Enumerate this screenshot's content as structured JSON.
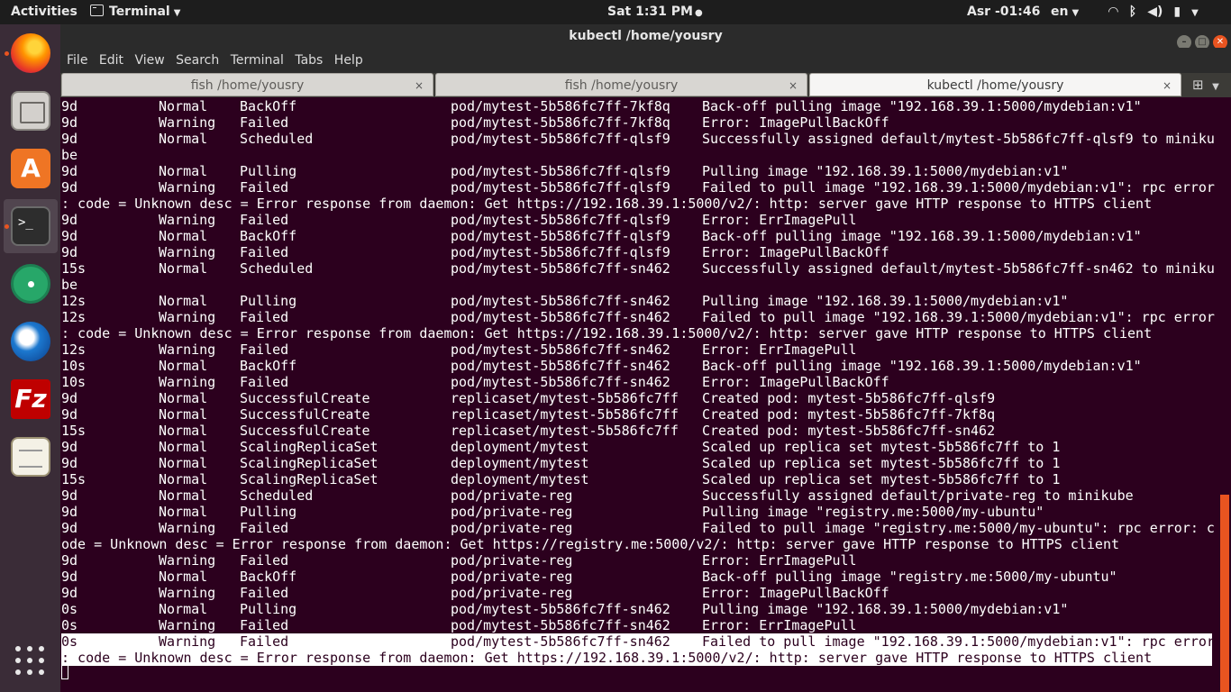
{
  "topbar": {
    "activities": "Activities",
    "app_name": "Terminal",
    "clock": "Sat  1:31 PM",
    "prayer": "Asr -01:46",
    "language": "en"
  },
  "dock": {
    "items": [
      "firefox-icon",
      "files-icon",
      "software-icon",
      "terminal-icon",
      "atom-icon",
      "thunderbird-icon",
      "filezilla-icon",
      "text-editor-icon"
    ],
    "software_glyph": "A",
    "terminal_glyph": ">_",
    "filezilla_glyph": "Fz"
  },
  "window": {
    "title": "kubectl  /home/yousry",
    "menu": [
      "File",
      "Edit",
      "View",
      "Search",
      "Terminal",
      "Tabs",
      "Help"
    ],
    "tabs": [
      {
        "label": "fish  /home/yousry"
      },
      {
        "label": "fish  /home/yousry"
      },
      {
        "label": "kubectl  /home/yousry"
      }
    ]
  },
  "colors": {
    "terminal_bg": "#2c001e",
    "accent": "#e95420",
    "titlebar": "#2b2b2b"
  },
  "terminal": {
    "lines": [
      {
        "t": "row",
        "c": [
          "9d",
          "Normal",
          "BackOff",
          "pod/mytest-5b586fc7ff-7kf8q",
          "Back-off pulling image \"192.168.39.1:5000/mydebian:v1\""
        ]
      },
      {
        "t": "row",
        "c": [
          "9d",
          "Warning",
          "Failed",
          "pod/mytest-5b586fc7ff-7kf8q",
          "Error: ImagePullBackOff"
        ]
      },
      {
        "t": "row",
        "c": [
          "9d",
          "Normal",
          "Scheduled",
          "pod/mytest-5b586fc7ff-qlsf9",
          "Successfully assigned default/mytest-5b586fc7ff-qlsf9 to miniku"
        ]
      },
      {
        "t": "wrap",
        "s": "be"
      },
      {
        "t": "row",
        "c": [
          "9d",
          "Normal",
          "Pulling",
          "pod/mytest-5b586fc7ff-qlsf9",
          "Pulling image \"192.168.39.1:5000/mydebian:v1\""
        ]
      },
      {
        "t": "row",
        "c": [
          "9d",
          "Warning",
          "Failed",
          "pod/mytest-5b586fc7ff-qlsf9",
          "Failed to pull image \"192.168.39.1:5000/mydebian:v1\": rpc error"
        ]
      },
      {
        "t": "wrap",
        "s": ": code = Unknown desc = Error response from daemon: Get https://192.168.39.1:5000/v2/: http: server gave HTTP response to HTTPS client"
      },
      {
        "t": "row",
        "c": [
          "9d",
          "Warning",
          "Failed",
          "pod/mytest-5b586fc7ff-qlsf9",
          "Error: ErrImagePull"
        ]
      },
      {
        "t": "row",
        "c": [
          "9d",
          "Normal",
          "BackOff",
          "pod/mytest-5b586fc7ff-qlsf9",
          "Back-off pulling image \"192.168.39.1:5000/mydebian:v1\""
        ]
      },
      {
        "t": "row",
        "c": [
          "9d",
          "Warning",
          "Failed",
          "pod/mytest-5b586fc7ff-qlsf9",
          "Error: ImagePullBackOff"
        ]
      },
      {
        "t": "row",
        "c": [
          "15s",
          "Normal",
          "Scheduled",
          "pod/mytest-5b586fc7ff-sn462",
          "Successfully assigned default/mytest-5b586fc7ff-sn462 to miniku"
        ]
      },
      {
        "t": "wrap",
        "s": "be"
      },
      {
        "t": "row",
        "c": [
          "12s",
          "Normal",
          "Pulling",
          "pod/mytest-5b586fc7ff-sn462",
          "Pulling image \"192.168.39.1:5000/mydebian:v1\""
        ]
      },
      {
        "t": "row",
        "c": [
          "12s",
          "Warning",
          "Failed",
          "pod/mytest-5b586fc7ff-sn462",
          "Failed to pull image \"192.168.39.1:5000/mydebian:v1\": rpc error"
        ]
      },
      {
        "t": "wrap",
        "s": ": code = Unknown desc = Error response from daemon: Get https://192.168.39.1:5000/v2/: http: server gave HTTP response to HTTPS client"
      },
      {
        "t": "row",
        "c": [
          "12s",
          "Warning",
          "Failed",
          "pod/mytest-5b586fc7ff-sn462",
          "Error: ErrImagePull"
        ]
      },
      {
        "t": "row",
        "c": [
          "10s",
          "Normal",
          "BackOff",
          "pod/mytest-5b586fc7ff-sn462",
          "Back-off pulling image \"192.168.39.1:5000/mydebian:v1\""
        ]
      },
      {
        "t": "row",
        "c": [
          "10s",
          "Warning",
          "Failed",
          "pod/mytest-5b586fc7ff-sn462",
          "Error: ImagePullBackOff"
        ]
      },
      {
        "t": "row",
        "c": [
          "9d",
          "Normal",
          "SuccessfulCreate",
          "replicaset/mytest-5b586fc7ff",
          "Created pod: mytest-5b586fc7ff-qlsf9"
        ]
      },
      {
        "t": "row",
        "c": [
          "9d",
          "Normal",
          "SuccessfulCreate",
          "replicaset/mytest-5b586fc7ff",
          "Created pod: mytest-5b586fc7ff-7kf8q"
        ]
      },
      {
        "t": "row",
        "c": [
          "15s",
          "Normal",
          "SuccessfulCreate",
          "replicaset/mytest-5b586fc7ff",
          "Created pod: mytest-5b586fc7ff-sn462"
        ]
      },
      {
        "t": "row",
        "c": [
          "9d",
          "Normal",
          "ScalingReplicaSet",
          "deployment/mytest",
          "Scaled up replica set mytest-5b586fc7ff to 1"
        ]
      },
      {
        "t": "row",
        "c": [
          "9d",
          "Normal",
          "ScalingReplicaSet",
          "deployment/mytest",
          "Scaled up replica set mytest-5b586fc7ff to 1"
        ]
      },
      {
        "t": "row",
        "c": [
          "15s",
          "Normal",
          "ScalingReplicaSet",
          "deployment/mytest",
          "Scaled up replica set mytest-5b586fc7ff to 1"
        ]
      },
      {
        "t": "row",
        "c": [
          "9d",
          "Normal",
          "Scheduled",
          "pod/private-reg",
          "Successfully assigned default/private-reg to minikube"
        ]
      },
      {
        "t": "row",
        "c": [
          "9d",
          "Normal",
          "Pulling",
          "pod/private-reg",
          "Pulling image \"registry.me:5000/my-ubuntu\""
        ]
      },
      {
        "t": "row",
        "c": [
          "9d",
          "Warning",
          "Failed",
          "pod/private-reg",
          "Failed to pull image \"registry.me:5000/my-ubuntu\": rpc error: c"
        ]
      },
      {
        "t": "wrap",
        "s": "ode = Unknown desc = Error response from daemon: Get https://registry.me:5000/v2/: http: server gave HTTP response to HTTPS client"
      },
      {
        "t": "row",
        "c": [
          "9d",
          "Warning",
          "Failed",
          "pod/private-reg",
          "Error: ErrImagePull"
        ]
      },
      {
        "t": "row",
        "c": [
          "9d",
          "Normal",
          "BackOff",
          "pod/private-reg",
          "Back-off pulling image \"registry.me:5000/my-ubuntu\""
        ]
      },
      {
        "t": "row",
        "c": [
          "9d",
          "Warning",
          "Failed",
          "pod/private-reg",
          "Error: ImagePullBackOff"
        ]
      },
      {
        "t": "row",
        "c": [
          "0s",
          "Normal",
          "Pulling",
          "pod/mytest-5b586fc7ff-sn462",
          "Pulling image \"192.168.39.1:5000/mydebian:v1\""
        ]
      },
      {
        "t": "row",
        "c": [
          "0s",
          "Warning",
          "Failed",
          "pod/mytest-5b586fc7ff-sn462",
          "Error: ErrImagePull"
        ]
      },
      {
        "t": "row",
        "hl": true,
        "c": [
          "0s",
          "Warning",
          "Failed",
          "pod/mytest-5b586fc7ff-sn462",
          "Failed to pull image \"192.168.39.1:5000/mydebian:v1\": rpc error"
        ]
      },
      {
        "t": "wrap",
        "hl": true,
        "s": ": code = Unknown desc = Error response from daemon: Get https://192.168.39.1:5000/v2/: http: server gave HTTP response to HTTPS client"
      }
    ]
  }
}
